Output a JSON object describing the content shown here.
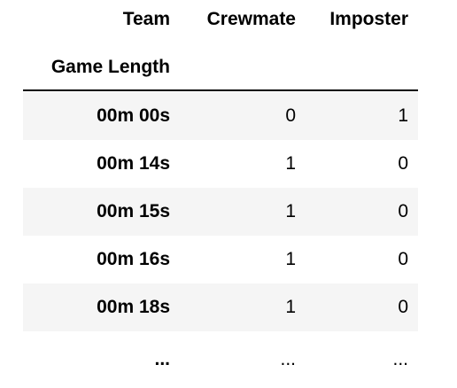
{
  "header": {
    "columns_label": "Team",
    "col1": "Crewmate",
    "col2": "Imposter",
    "index_name": "Game Length"
  },
  "rows": [
    {
      "index": "00m 00s",
      "crewmate": "0",
      "imposter": "1"
    },
    {
      "index": "00m 14s",
      "crewmate": "1",
      "imposter": "0"
    },
    {
      "index": "00m 15s",
      "crewmate": "1",
      "imposter": "0"
    },
    {
      "index": "00m 16s",
      "crewmate": "1",
      "imposter": "0"
    },
    {
      "index": "00m 18s",
      "crewmate": "1",
      "imposter": "0"
    }
  ],
  "ellipsis": {
    "index": "...",
    "crewmate": "...",
    "imposter": "..."
  }
}
